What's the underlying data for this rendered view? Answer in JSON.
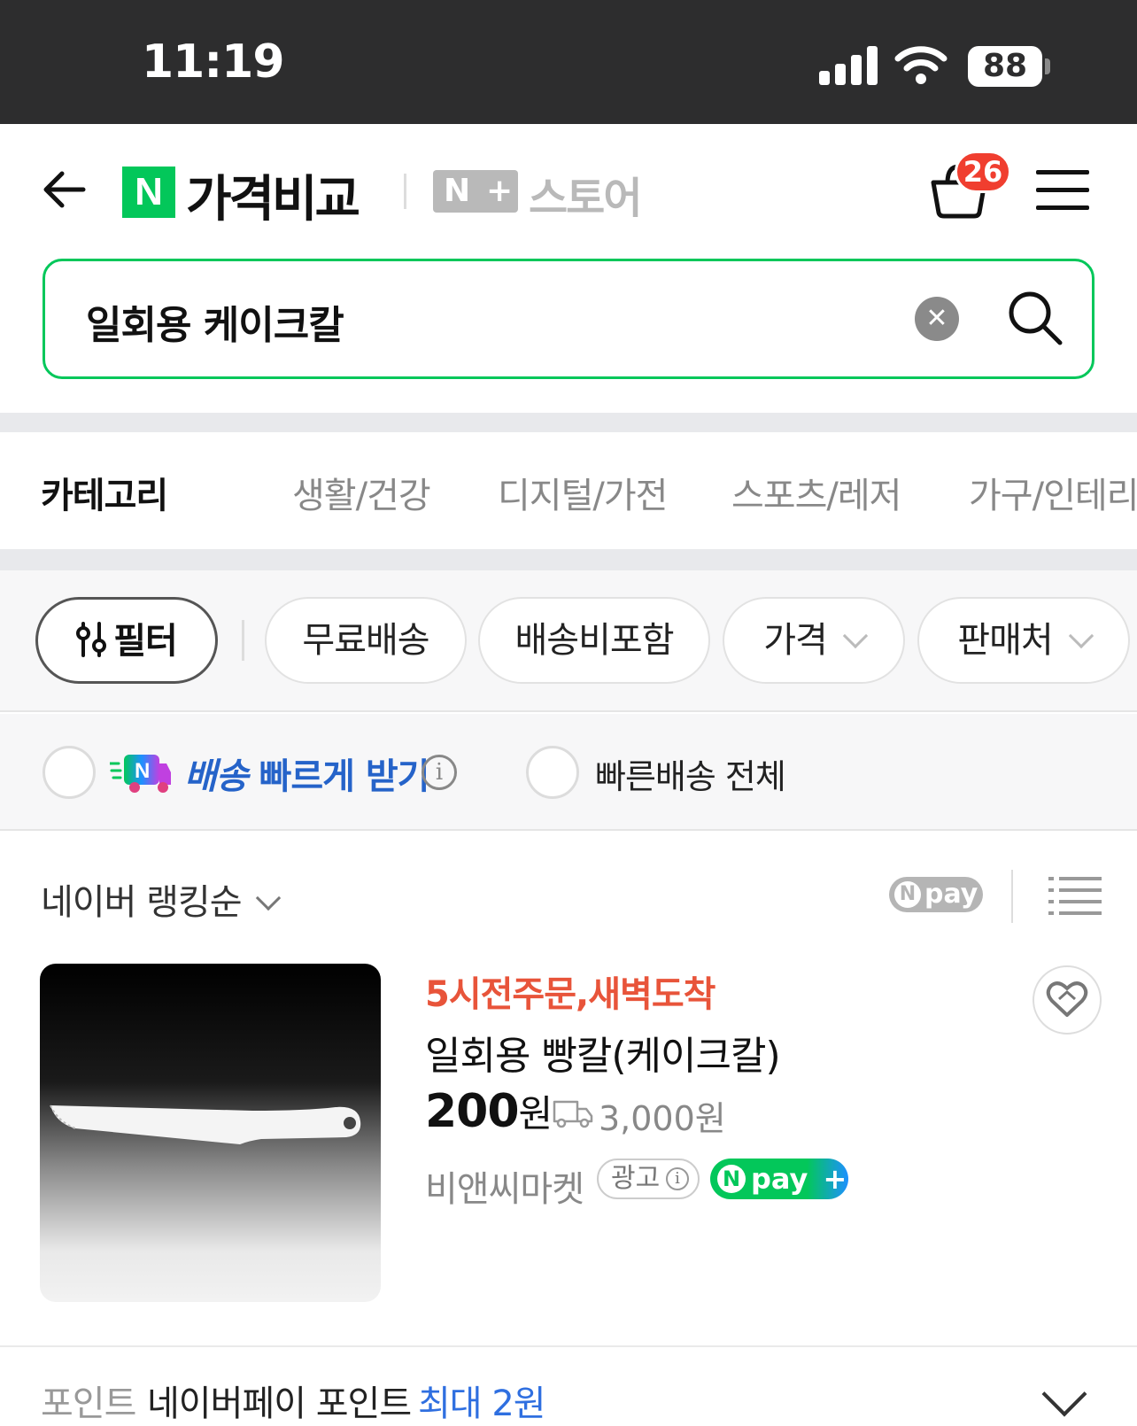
{
  "status_bar": {
    "time": "11:19",
    "battery": "88"
  },
  "header": {
    "brand_logo": "N",
    "brand_title": "가격비교",
    "store_logo_left": "N",
    "store_logo_right": "+",
    "store_label": "스토어",
    "cart_count": "26",
    "icons": [
      "back-arrow-icon",
      "shopping-bag-icon",
      "hamburger-menu-icon"
    ]
  },
  "search": {
    "query": "일회용 케이크칼",
    "clear_icon": "✕"
  },
  "categories": {
    "label": "카테고리",
    "items": [
      "생활/건강",
      "디지털/가전",
      "스포츠/레저",
      "가구/인테리"
    ]
  },
  "filters": {
    "filter_label": "필터",
    "chips": [
      "무료배송",
      "배송비포함",
      "가격",
      "판매처"
    ]
  },
  "fast_delivery": {
    "brand_letter": "N",
    "label_part1": "배송",
    "label_part2": "빠르게 받기",
    "info_icon": "i",
    "all_label": "빠른배송 전체"
  },
  "sort": {
    "label": "네이버 랭킹순",
    "npay_label": "pay",
    "npay_letter": "N"
  },
  "product": {
    "badge": "5시전주문,새벽도착",
    "title": "일회용 빵칼(케이크칼)",
    "price_number": "200",
    "price_unit": "원",
    "shipping_fee": "3,000원",
    "seller": "비앤씨마켓",
    "ad_label": "광고",
    "npay_plus_label": "pay",
    "npay_plus_letter": "N",
    "npay_plus_sign": "+"
  },
  "points": {
    "label": "포인트",
    "desc": "네이버페이 포인트",
    "max": "최대 2원"
  },
  "colors": {
    "naver_green": "#03c75a",
    "badge_red": "#f03e2f",
    "promo_orange": "#e8543a",
    "link_blue": "#2f6fe0"
  }
}
